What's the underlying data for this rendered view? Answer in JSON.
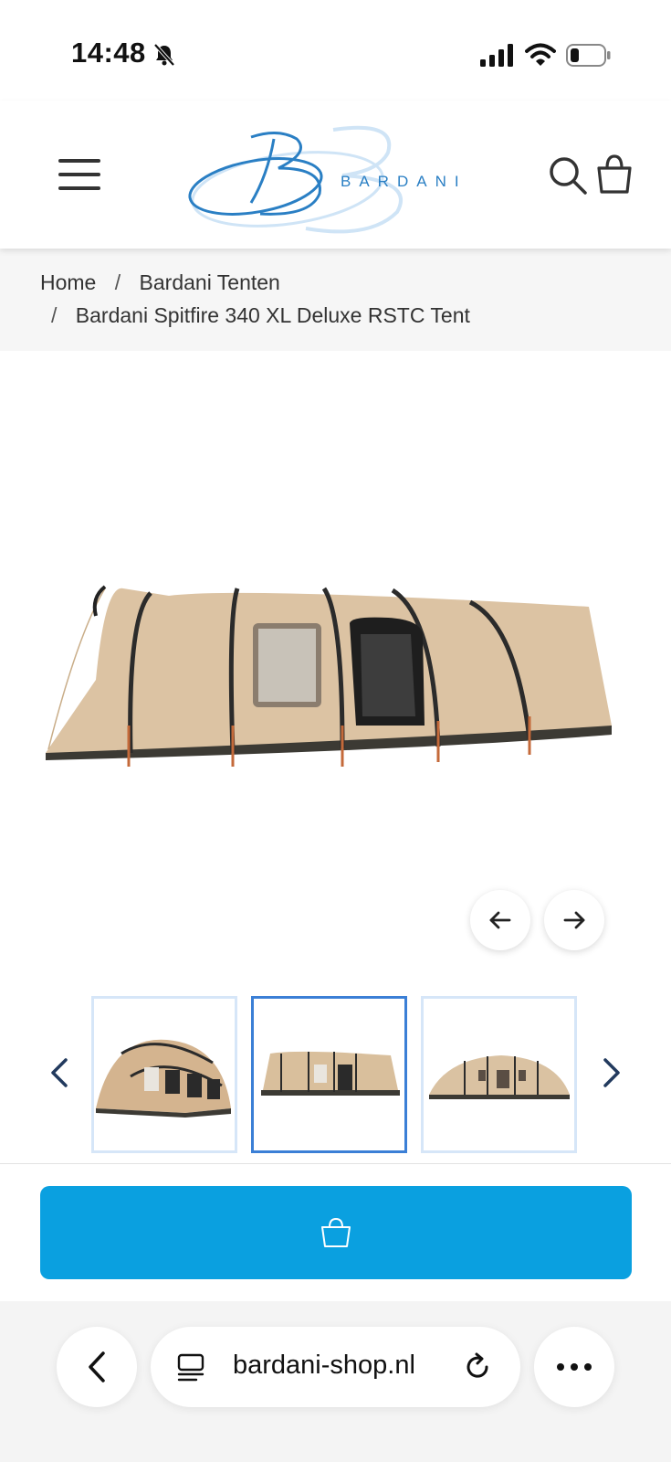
{
  "status_bar": {
    "time": "14:48",
    "icons": [
      "bell-slash-icon",
      "cellular-signal-icon",
      "wifi-icon",
      "battery-icon"
    ]
  },
  "header": {
    "logo_text": "BARDANI",
    "menu_icon": "hamburger-menu-icon",
    "search_icon": "search-icon",
    "cart_icon": "shopping-bag-icon"
  },
  "breadcrumb": {
    "items": [
      "Home",
      "Bardani Tenten",
      "Bardani Spitfire 340 XL Deluxe RSTC Tent"
    ],
    "separator": "/"
  },
  "gallery": {
    "prev_icon": "arrow-left-icon",
    "next_icon": "arrow-right-icon",
    "thumb_prev_icon": "chevron-left-icon",
    "thumb_next_icon": "chevron-right-icon",
    "active_thumbnail": 2
  },
  "add_to_cart": {
    "icon": "shopping-bag-icon",
    "color": "#0aa0e0"
  },
  "browser": {
    "url": "bardani-shop.nl",
    "back_icon": "chevron-left-icon",
    "page_icon": "reader-icon",
    "reload_icon": "reload-icon",
    "more_icon": "ellipsis-icon"
  },
  "colors": {
    "accent_blue": "#0aa0e0",
    "thumb_active_border": "#3b7fd6",
    "logo_blue": "#2a7fc4",
    "tent_beige": "#dcc3a3"
  }
}
